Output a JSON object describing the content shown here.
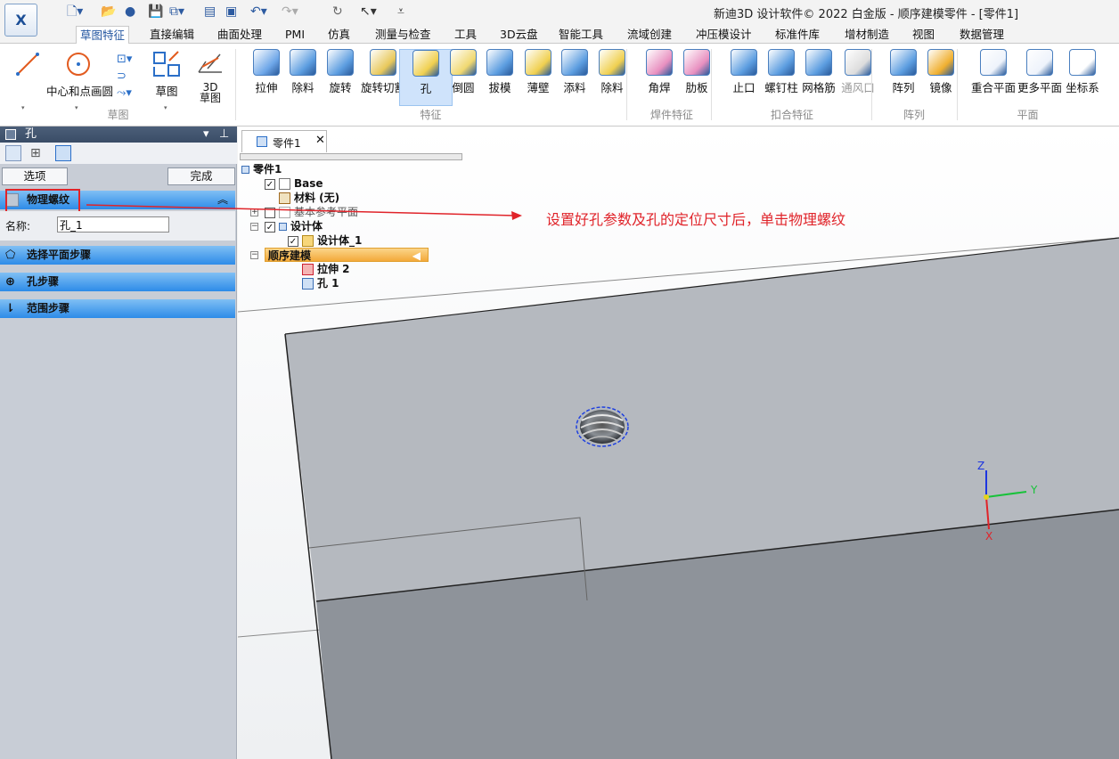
{
  "app": {
    "title": "新迪3D 设计软件© 2022 白金版 - 顺序建模零件 - [零件1]",
    "logo_icon": "xd-logo-icon"
  },
  "tabs": [
    "草图特征",
    "直接编辑",
    "曲面处理",
    "PMI",
    "仿真",
    "测量与检查",
    "工具",
    "3D云盘",
    "智能工具",
    "流域创建",
    "冲压模设计",
    "标准件库",
    "增材制造",
    "视图",
    "数据管理"
  ],
  "ribbon": {
    "sketch_group": {
      "label": "草图",
      "circle_label": "中心和点画圆",
      "sketch_label": "草图",
      "sketch3d_label": "3D\n草图"
    },
    "features_group": {
      "label": "特征",
      "items": [
        "拉伸",
        "除料",
        "旋转",
        "旋转切割",
        "孔",
        "倒圆",
        "拔模",
        "薄壁",
        "添料",
        "除料"
      ]
    },
    "weld_group": {
      "label": "焊件特征",
      "items": [
        "角焊",
        "肋板"
      ]
    },
    "snap_group": {
      "label": "扣合特征",
      "items": [
        "止口",
        "螺钉柱",
        "网格筋",
        "通风口"
      ]
    },
    "array_group": {
      "label": "阵列",
      "items": [
        "阵列",
        "镜像"
      ]
    },
    "plane_group": {
      "label": "平面",
      "items": [
        "重合平面",
        "更多平面",
        "坐标系"
      ]
    }
  },
  "left_panel": {
    "title": "孔",
    "options_button": "选项",
    "finish_button": "完成",
    "physical_thread_label": "物理螺纹",
    "name_label": "名称:",
    "name_value": "孔_1",
    "steps": [
      "选择平面步骤",
      "孔步骤",
      "范围步骤"
    ]
  },
  "document_tab": "零件1",
  "tree": {
    "root": "零件1",
    "base": "Base",
    "material": "材料 (无)",
    "ref_planes": "基本参考平面",
    "design_body": "设计体",
    "design_body_child": "设计体_1",
    "sequential": "顺序建模",
    "extrude": "拉伸 2",
    "hole": "孔 1"
  },
  "annotation": "设置好孔参数及孔的定位尺寸后，单击物理螺纹",
  "triad": {
    "z": "Z",
    "y": "Y",
    "x": "X"
  },
  "colors": {
    "accent": "#2b7fe0",
    "annotation": "#e0242a",
    "model_face": "#b2b7bd"
  }
}
